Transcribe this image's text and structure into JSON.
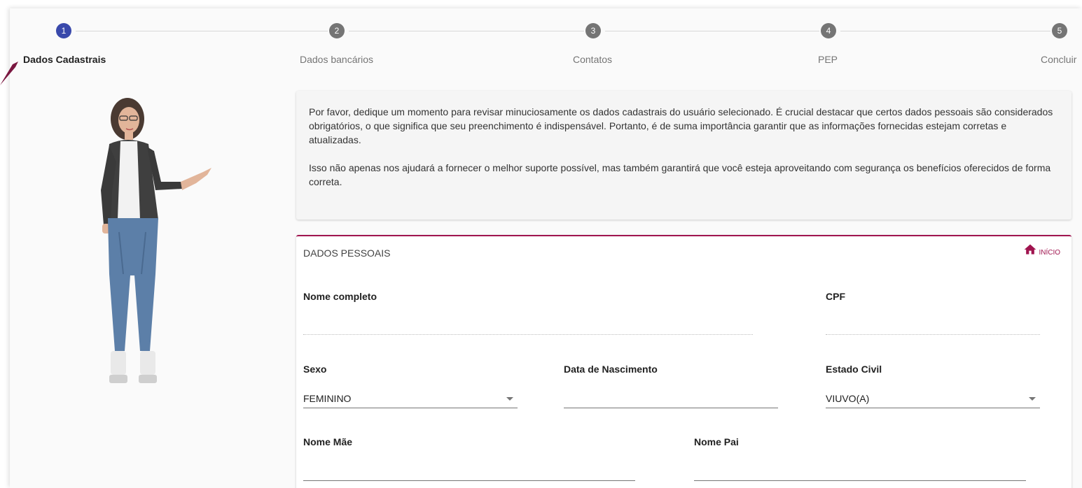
{
  "stepper": {
    "steps": [
      {
        "number": "1",
        "label": "Dados Cadastrais",
        "active": true
      },
      {
        "number": "2",
        "label": "Dados bancários",
        "active": false
      },
      {
        "number": "3",
        "label": "Contatos",
        "active": false
      },
      {
        "number": "4",
        "label": "PEP",
        "active": false
      },
      {
        "number": "5",
        "label": "Concluir",
        "active": false
      }
    ]
  },
  "info": {
    "paragraph1": "Por favor, dedique um momento para revisar minuciosamente os dados cadastrais do usuário selecionado. É crucial destacar que certos dados pessoais são considerados obrigatórios, o que significa que seu preenchimento é indispensável. Portanto, é de suma importância garantir que as informações fornecidas estejam corretas e atualizadas.",
    "paragraph2": "Isso não apenas nos ajudará a fornecer o melhor suporte possível, mas também garantirá que você esteja aproveitando com segurança os benefícios oferecidos de forma correta."
  },
  "form": {
    "section_title": "DADOS PESSOAIS",
    "home_label": "INÍCIO",
    "nome_completo_label": "Nome completo",
    "cpf_label": "CPF",
    "sexo_label": "Sexo",
    "sexo_value": "FEMININO",
    "data_nascimento_label": "Data de Nascimento",
    "estado_civil_label": "Estado Civil",
    "estado_civil_value": "VIUVO(A)",
    "nome_mae_label": "Nome Mãe",
    "nome_pai_label": "Nome Pai"
  },
  "colors": {
    "accent": "#a0144f",
    "step_active": "#3949ab",
    "step_inactive": "#757575"
  },
  "icons": {
    "home": "home-icon",
    "avatar": "assistant-avatar",
    "caret": "chevron-down-icon"
  }
}
